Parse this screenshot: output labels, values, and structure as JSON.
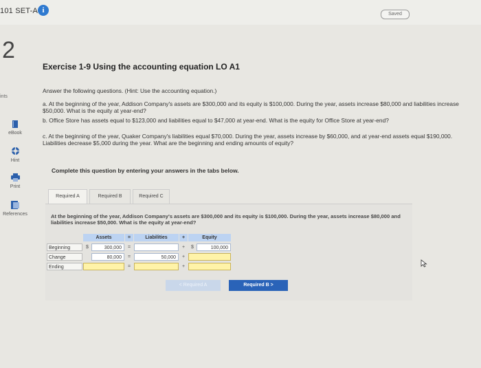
{
  "header": {
    "set_label": "101 SET-A 1",
    "info_icon": "i",
    "saved_label": "Saved"
  },
  "question_number": "2",
  "points_label": "ints",
  "sidebar": {
    "items": [
      {
        "label": "eBook",
        "icon": "book-icon"
      },
      {
        "label": "Hint",
        "icon": "lifebuoy-icon"
      },
      {
        "label": "Print",
        "icon": "print-icon"
      },
      {
        "label": "References",
        "icon": "references-icon"
      }
    ]
  },
  "exercise_title": "Exercise 1-9 Using the accounting equation LO A1",
  "intro": "Answer the following questions. (Hint: Use the accounting equation.)",
  "questions": {
    "a": "a. At the beginning of the year, Addison Company's assets are $300,000 and its equity is $100,000. During the year, assets increase $80,000 and liabilities increase $50,000. What is the equity at year-end?",
    "b": "b. Office Store has assets equal to $123,000 and liabilities equal to $47,000 at year-end. What is the equity for Office Store at year-end?",
    "c": "c. At the beginning of the year, Quaker Company's liabilities equal $70,000. During the year, assets increase by $60,000, and at year-end assets equal $190,000. Liabilities decrease $5,000 during the year. What are the beginning and ending amounts of equity?"
  },
  "panel_title": "Complete this question by entering your answers in the tabs below.",
  "tabs": [
    "Required A",
    "Required B",
    "Required C"
  ],
  "required_a_text": "At the beginning of the year, Addison Company's assets are $300,000 and its equity is $100,000. During the year, assets increase $80,000 and liabilities increase $50,000. What is the equity at year-end?",
  "equation": {
    "headers": {
      "assets": "Assets",
      "eq": "=",
      "liabilities": "Liabilities",
      "plus": "+",
      "equity": "Equity"
    },
    "rows": [
      {
        "label": "Beginning",
        "dollar": "$",
        "assets": "300,000",
        "eq": "=",
        "liabilities": "",
        "plus": "+",
        "equity_dollar": "$",
        "equity": "100,000"
      },
      {
        "label": "Change",
        "dollar": "",
        "assets": "80,000",
        "eq": "=",
        "liabilities": "50,000",
        "plus": "+",
        "equity_dollar": "",
        "equity": ""
      },
      {
        "label": "Ending",
        "dollar": "",
        "assets": "",
        "eq": "=",
        "liabilities": "",
        "plus": "+",
        "equity_dollar": "",
        "equity": ""
      }
    ]
  },
  "nav": {
    "prev": "< Required A",
    "next": "Required B  >"
  }
}
